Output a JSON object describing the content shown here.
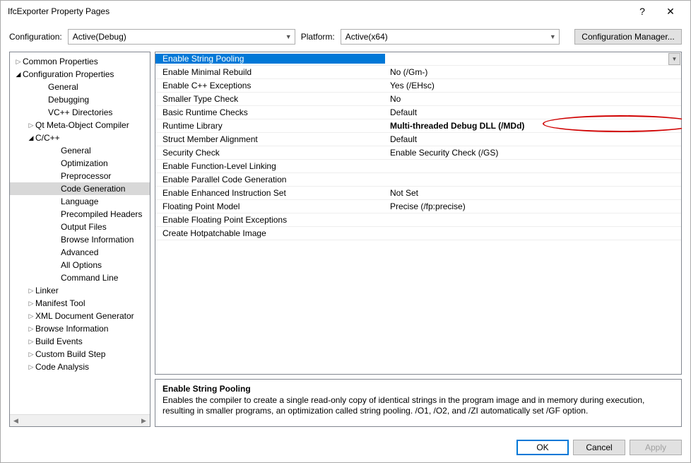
{
  "window": {
    "title": "IfcExporter Property Pages",
    "help": "?",
    "close": "✕"
  },
  "configRow": {
    "configLabel": "Configuration:",
    "configValue": "Active(Debug)",
    "platformLabel": "Platform:",
    "platformValue": "Active(x64)",
    "managerButton": "Configuration Manager..."
  },
  "tree": [
    {
      "label": "Common Properties",
      "indent": 0,
      "arrow": "closed"
    },
    {
      "label": "Configuration Properties",
      "indent": 0,
      "arrow": "open"
    },
    {
      "label": "General",
      "indent": 2,
      "arrow": "none"
    },
    {
      "label": "Debugging",
      "indent": 2,
      "arrow": "none"
    },
    {
      "label": "VC++ Directories",
      "indent": 2,
      "arrow": "none"
    },
    {
      "label": "Qt Meta-Object Compiler",
      "indent": 1,
      "arrow": "closed"
    },
    {
      "label": "C/C++",
      "indent": 1,
      "arrow": "open"
    },
    {
      "label": "General",
      "indent": 3,
      "arrow": "none"
    },
    {
      "label": "Optimization",
      "indent": 3,
      "arrow": "none"
    },
    {
      "label": "Preprocessor",
      "indent": 3,
      "arrow": "none"
    },
    {
      "label": "Code Generation",
      "indent": 3,
      "arrow": "none",
      "selected": true
    },
    {
      "label": "Language",
      "indent": 3,
      "arrow": "none"
    },
    {
      "label": "Precompiled Headers",
      "indent": 3,
      "arrow": "none"
    },
    {
      "label": "Output Files",
      "indent": 3,
      "arrow": "none"
    },
    {
      "label": "Browse Information",
      "indent": 3,
      "arrow": "none"
    },
    {
      "label": "Advanced",
      "indent": 3,
      "arrow": "none"
    },
    {
      "label": "All Options",
      "indent": 3,
      "arrow": "none"
    },
    {
      "label": "Command Line",
      "indent": 3,
      "arrow": "none"
    },
    {
      "label": "Linker",
      "indent": 1,
      "arrow": "closed"
    },
    {
      "label": "Manifest Tool",
      "indent": 1,
      "arrow": "closed"
    },
    {
      "label": "XML Document Generator",
      "indent": 1,
      "arrow": "closed"
    },
    {
      "label": "Browse Information",
      "indent": 1,
      "arrow": "closed"
    },
    {
      "label": "Build Events",
      "indent": 1,
      "arrow": "closed"
    },
    {
      "label": "Custom Build Step",
      "indent": 1,
      "arrow": "closed"
    },
    {
      "label": "Code Analysis",
      "indent": 1,
      "arrow": "closed"
    }
  ],
  "grid": [
    {
      "label": "Enable String Pooling",
      "value": "",
      "selected": true
    },
    {
      "label": "Enable Minimal Rebuild",
      "value": "No (/Gm-)"
    },
    {
      "label": "Enable C++ Exceptions",
      "value": "Yes (/EHsc)"
    },
    {
      "label": "Smaller Type Check",
      "value": "No"
    },
    {
      "label": "Basic Runtime Checks",
      "value": "Default"
    },
    {
      "label": "Runtime Library",
      "value": "Multi-threaded Debug DLL (/MDd)",
      "bold": true
    },
    {
      "label": "Struct Member Alignment",
      "value": "Default"
    },
    {
      "label": "Security Check",
      "value": "Enable Security Check (/GS)"
    },
    {
      "label": "Enable Function-Level Linking",
      "value": ""
    },
    {
      "label": "Enable Parallel Code Generation",
      "value": ""
    },
    {
      "label": "Enable Enhanced Instruction Set",
      "value": "Not Set"
    },
    {
      "label": "Floating Point Model",
      "value": "Precise (/fp:precise)"
    },
    {
      "label": "Enable Floating Point Exceptions",
      "value": ""
    },
    {
      "label": "Create Hotpatchable Image",
      "value": ""
    }
  ],
  "description": {
    "title": "Enable String Pooling",
    "text": "Enables the compiler to create a single read-only copy of identical strings in the program image and in memory during execution, resulting in smaller programs, an optimization called string pooling. /O1, /O2, and /ZI  automatically set /GF option."
  },
  "buttons": {
    "ok": "OK",
    "cancel": "Cancel",
    "apply": "Apply"
  }
}
